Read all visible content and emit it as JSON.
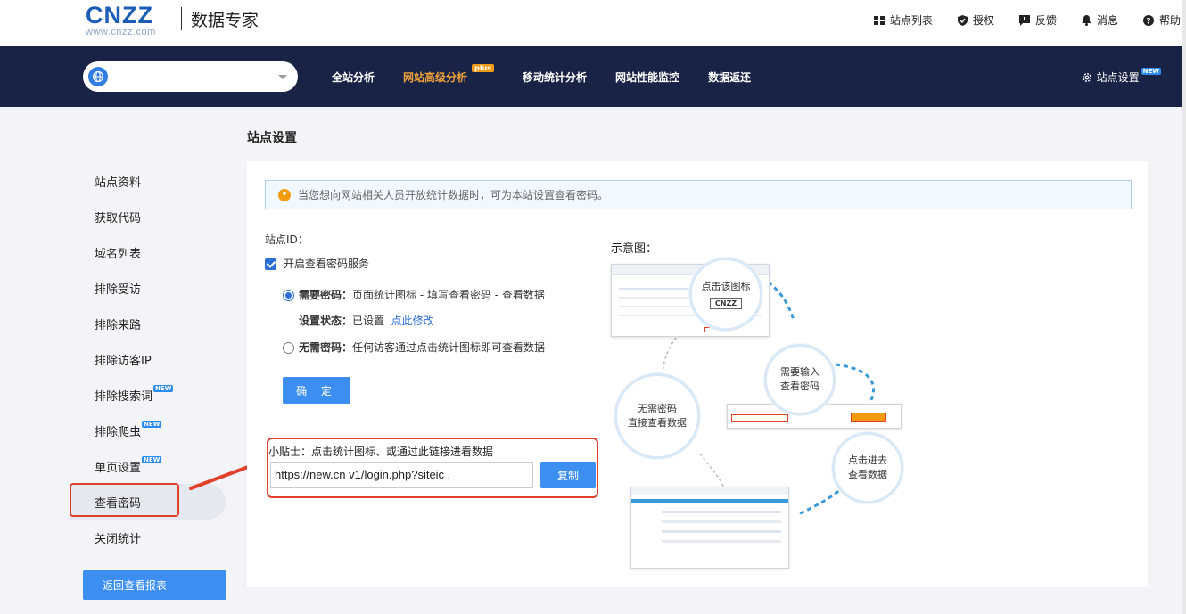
{
  "header": {
    "logo_text": "CNZZ",
    "logo_sub": "www.cnzz.com",
    "product": "数据专家",
    "links": [
      {
        "label": "站点列表",
        "icon": "site-list-icon"
      },
      {
        "label": "授权",
        "icon": "shield-icon"
      },
      {
        "label": "反馈",
        "icon": "feedback-icon"
      },
      {
        "label": "消息",
        "icon": "bell-icon"
      },
      {
        "label": "帮助",
        "icon": "help-icon"
      }
    ]
  },
  "nav": {
    "site_select_value": "",
    "items": [
      {
        "label": "全站分析"
      },
      {
        "label": "网站高级分析",
        "badge": "plus"
      },
      {
        "label": "移动统计分析"
      },
      {
        "label": "网站性能监控"
      },
      {
        "label": "数据返还"
      }
    ],
    "settings_label": "站点设置",
    "settings_badge": "NEW"
  },
  "page_title": "站点设置",
  "sidebar": {
    "items": [
      {
        "label": "站点资料"
      },
      {
        "label": "获取代码"
      },
      {
        "label": "域名列表"
      },
      {
        "label": "排除受访"
      },
      {
        "label": "排除来路"
      },
      {
        "label": "排除访客IP"
      },
      {
        "label": "排除搜索词",
        "badge": "NEW"
      },
      {
        "label": "排除爬虫",
        "badge": "NEW"
      },
      {
        "label": "单页设置",
        "badge": "NEW"
      },
      {
        "label": "查看密码"
      },
      {
        "label": "关闭统计"
      }
    ],
    "active": "查看密码",
    "back_button": "返回查看报表"
  },
  "main": {
    "notice": "当您想向网站相关人员开放统计数据时，可为本站设置查看密码。",
    "site_id_label": "站点ID：",
    "enable_label": "开启查看密码服务",
    "need_password_title": "需要密码：",
    "need_password_desc": "页面统计图标 - 填写查看密码 - 查看数据",
    "status_label": "设置状态：",
    "status_value": "已设置",
    "modify_link": "点此修改",
    "no_password_title": "无需密码：",
    "no_password_desc": "任何访客通过点击统计图标即可查看数据",
    "confirm_button": "确 定",
    "tip": "小贴士：点击统计图标、或通过此链接进看数据",
    "link_value": "https://new.cn          v1/login.php?siteic        ,",
    "copy_button": "复制"
  },
  "diagram": {
    "title": "示意图：",
    "bubble_click_icon": "点击该图标",
    "icon_label": "CNZZ",
    "bubble_need_line1": "需要输入",
    "bubble_need_line2": "查看密码",
    "bubble_no_line1": "无需密码",
    "bubble_no_line2": "直接查看数据",
    "bubble_enter_line1": "点击进去",
    "bubble_enter_line2": "查看数据"
  },
  "colors": {
    "navbar": "#192345",
    "accent": "#3c8ff0",
    "active_nav": "#f3a33b",
    "highlight": "#e1412a"
  }
}
